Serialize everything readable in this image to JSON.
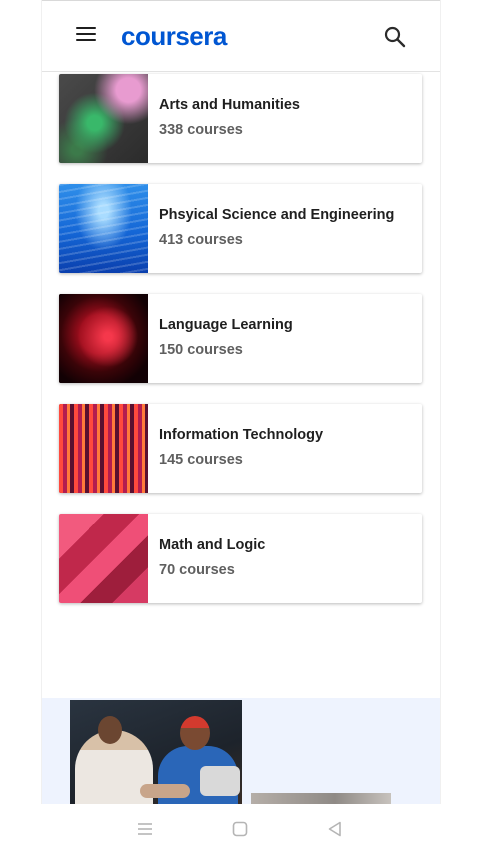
{
  "header": {
    "logo_text": "coursera",
    "brand_color": "#0056d2",
    "menu_icon": "hamburger-menu-icon",
    "search_icon": "search-icon"
  },
  "categories": [
    {
      "title": "Arts and Humanities",
      "count": "338 courses"
    },
    {
      "title": "Phsyical Science and Engineering",
      "count": "413 courses"
    },
    {
      "title": "Language Learning",
      "count": "150 courses"
    },
    {
      "title": "Information Technology",
      "count": "145 courses"
    },
    {
      "title": "Math and Logic",
      "count": "70 courses"
    }
  ],
  "system_nav": {
    "icons": [
      "recent-apps-icon",
      "home-icon",
      "back-icon"
    ]
  }
}
